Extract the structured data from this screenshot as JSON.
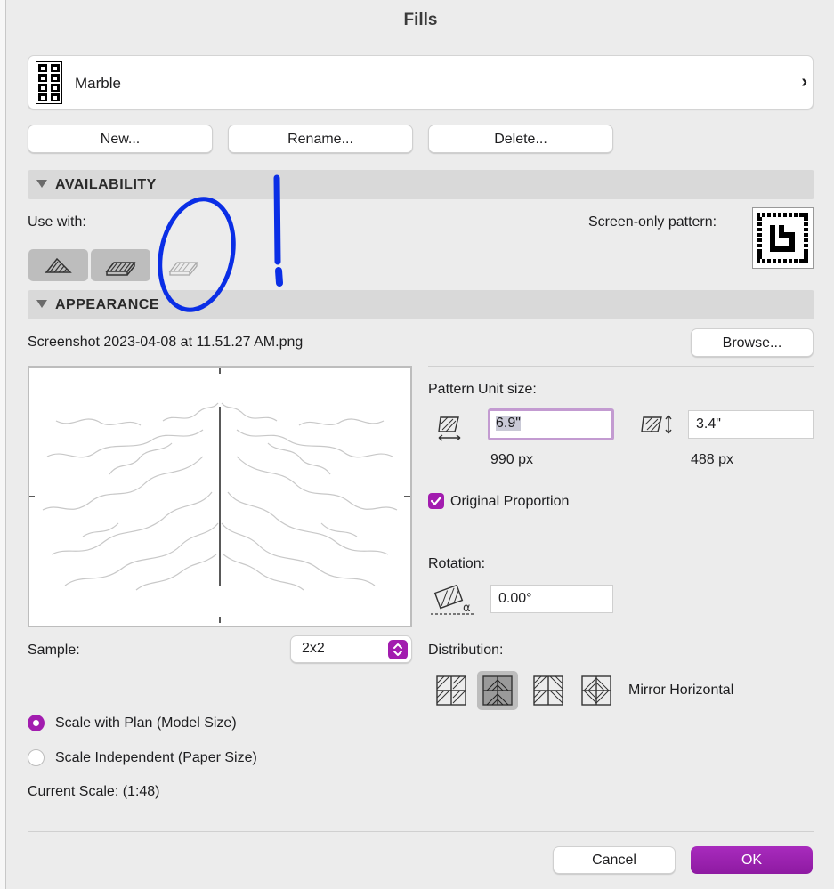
{
  "window": {
    "title": "Fills"
  },
  "fill_selector": {
    "name": "Marble"
  },
  "actions": {
    "new_label": "New...",
    "rename_label": "Rename...",
    "delete_label": "Delete..."
  },
  "availability": {
    "header": "AVAILABILITY",
    "use_with_label": "Use with:",
    "screen_only_label": "Screen-only pattern:",
    "use_with_buttons": [
      {
        "icon": "drafting-fill-icon",
        "selected": true
      },
      {
        "icon": "cut-fill-icon",
        "selected": true
      },
      {
        "icon": "cover-fill-icon",
        "selected": false
      }
    ]
  },
  "appearance": {
    "header": "APPEARANCE",
    "file_name": "Screenshot 2023-04-08 at 11.51.27 AM.png",
    "browse_label": "Browse...",
    "pattern_unit_label": "Pattern Unit size:",
    "width_value": "6.9\"",
    "width_px": "990 px",
    "height_value": "3.4\"",
    "height_px": "488 px",
    "original_proportion_label": "Original Proportion",
    "original_proportion_checked": true,
    "rotation_label": "Rotation:",
    "rotation_value": "0.00°",
    "distribution_label": "Distribution:",
    "distribution_mode": "Mirror Horizontal",
    "sample_label": "Sample:",
    "sample_value": "2x2",
    "scale_with_plan_label": "Scale with Plan (Model Size)",
    "scale_independent_label": "Scale Independent (Paper Size)",
    "scale_mode": "Scale with Plan (Model Size)",
    "current_scale_label": "Current Scale: (1:48)"
  },
  "footer": {
    "cancel_label": "Cancel",
    "ok_label": "OK"
  },
  "colors": {
    "accent": "#a21caf",
    "annotation": "#0a2ee6",
    "ok": "#9b1fb0"
  }
}
